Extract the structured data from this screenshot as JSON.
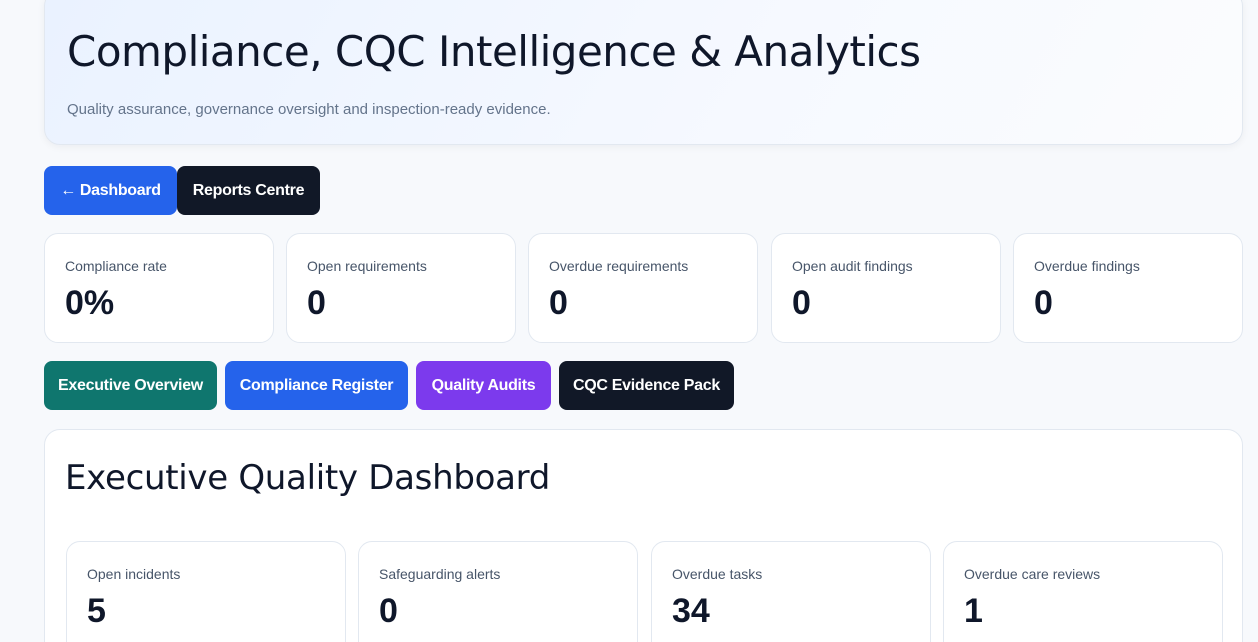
{
  "header": {
    "title": "Compliance, CQC Intelligence & Analytics",
    "subtitle": "Quality assurance, governance oversight and inspection-ready evidence."
  },
  "nav": {
    "dashboard_arrow": "←",
    "dashboard_label": "Dashboard",
    "reports_label": "Reports Centre"
  },
  "kpis": [
    {
      "label": "Compliance rate",
      "value": "0%"
    },
    {
      "label": "Open requirements",
      "value": "0"
    },
    {
      "label": "Overdue requirements",
      "value": "0"
    },
    {
      "label": "Open audit findings",
      "value": "0"
    },
    {
      "label": "Overdue findings",
      "value": "0"
    }
  ],
  "tabs": [
    {
      "label": "Executive Overview",
      "color": "#0f766e"
    },
    {
      "label": "Compliance Register",
      "color": "#2563eb"
    },
    {
      "label": "Quality Audits",
      "color": "#7c3aed"
    },
    {
      "label": "CQC Evidence Pack",
      "color": "#111827"
    }
  ],
  "executive": {
    "title": "Executive Quality Dashboard",
    "cards": [
      {
        "label": "Open incidents",
        "value": "5"
      },
      {
        "label": "Safeguarding alerts",
        "value": "0"
      },
      {
        "label": "Overdue tasks",
        "value": "34"
      },
      {
        "label": "Overdue care reviews",
        "value": "1"
      }
    ]
  }
}
